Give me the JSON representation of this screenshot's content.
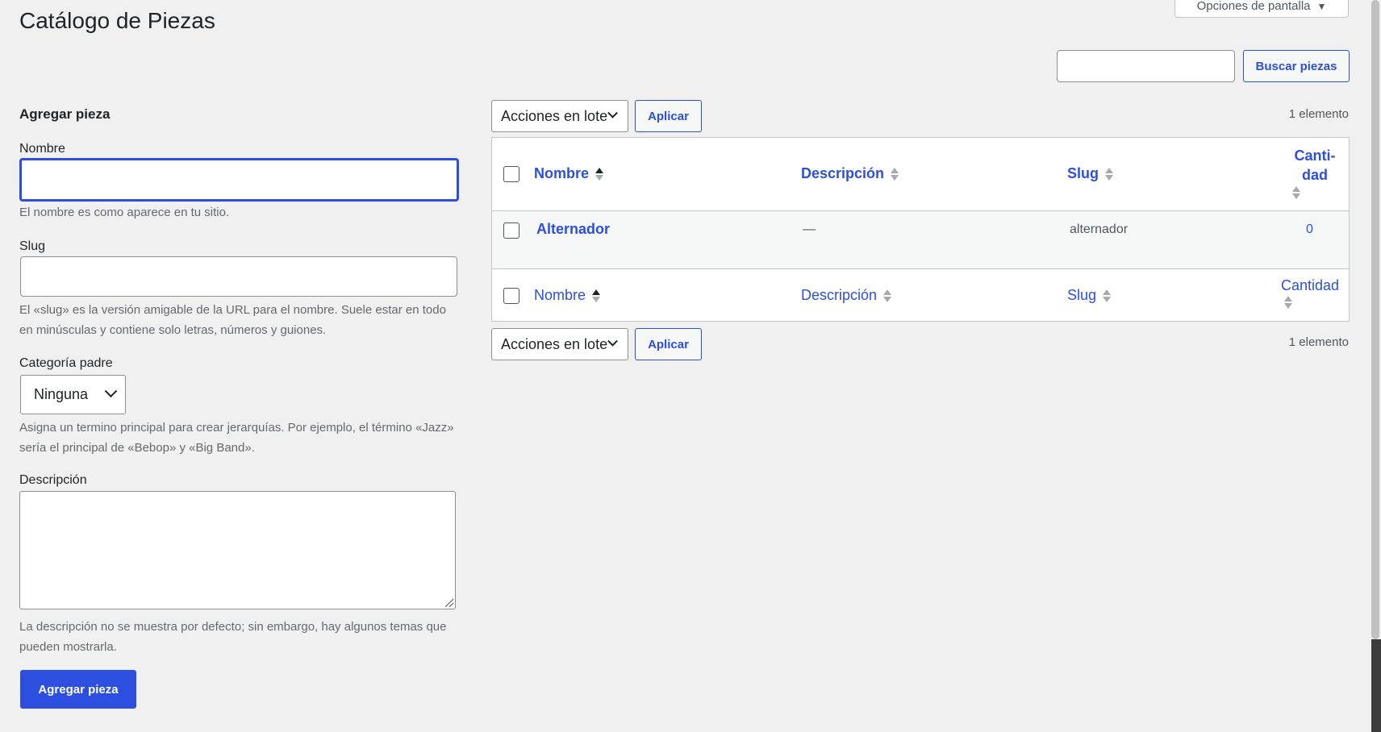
{
  "header": {
    "title": "Catálogo de Piezas",
    "screen_options": "Opciones de pantalla",
    "search_button": "Buscar piezas"
  },
  "form": {
    "title": "Agregar pieza",
    "name_label": "Nombre",
    "name_help": "El nombre es como aparece en tu sitio.",
    "slug_label": "Slug",
    "slug_help": "El «slug» es la versión amigable de la URL para el nombre. Suele estar en todo en minúsculas y contiene solo letras, números y guiones.",
    "parent_label": "Categoría padre",
    "parent_value": "Ninguna",
    "parent_help": "Asigna un termino principal para crear jerarquías. Por ejemplo, el término «Jazz» sería el principal de «Bebop» y «Big Band».",
    "desc_label": "Descripción",
    "desc_help": "La descripción no se muestra por defecto; sin embargo, hay algunos temas que pueden mostrarla.",
    "submit": "Agregar pieza"
  },
  "list": {
    "bulk_actions": "Acciones en lote",
    "apply": "Aplicar",
    "count": "1 elemento",
    "columns": {
      "name": "Nombre",
      "description": "Descripción",
      "slug": "Slug",
      "count_head_line1": "Canti-",
      "count_head_line2": "dad",
      "count_foot": "Cantidad"
    },
    "rows": [
      {
        "name": "Alternador",
        "description": "—",
        "slug": "alternador",
        "count": "0"
      }
    ]
  },
  "icons": {
    "dropdown": "chevron-down-icon",
    "sort": "sort-arrows-icon",
    "resize": "resize-handle-icon",
    "screen_options": "triangle-down-icon"
  }
}
